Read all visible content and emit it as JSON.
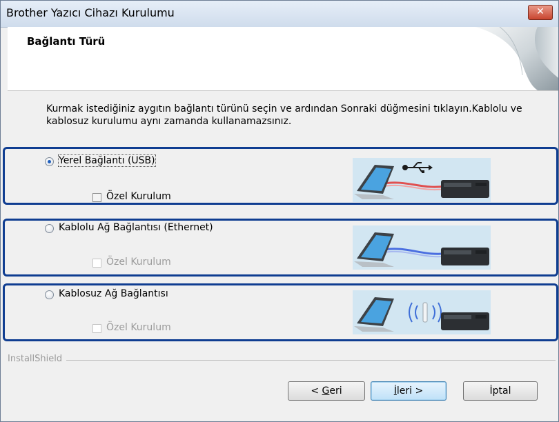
{
  "window": {
    "title": "Brother Yazıcı Cihazı Kurulumu",
    "close_glyph": "✕"
  },
  "header": {
    "heading": "Bağlantı Türü"
  },
  "instructions": "Kurmak istediğiniz aygıtın bağlantı türünü seçin ve ardından Sonraki düğmesini tıklayın.Kablolu ve kablosuz kurulumu aynı zamanda kullanamazsınız.",
  "options": [
    {
      "label": "Yerel Bağlantı (USB)",
      "selected": true,
      "custom_label": "Özel Kurulum",
      "custom_enabled": true,
      "image": "usb-connection-illustration"
    },
    {
      "label": "Kablolu Ağ Bağlantısı (Ethernet)",
      "selected": false,
      "custom_label": "Özel Kurulum",
      "custom_enabled": false,
      "image": "ethernet-connection-illustration"
    },
    {
      "label": "Kablosuz Ağ Bağlantısı",
      "selected": false,
      "custom_label": "Özel Kurulum",
      "custom_enabled": false,
      "image": "wireless-connection-illustration"
    }
  ],
  "footer": {
    "brand": "InstallShield"
  },
  "buttons": {
    "back_prefix": "< ",
    "back_key": "G",
    "back_rest": "eri",
    "next_key": "İ",
    "next_rest": "leri >",
    "cancel": "İptal"
  },
  "colors": {
    "highlight_frame": "#0f3d91",
    "usb_cable": "#e05050",
    "ethernet_cable": "#4a6ee0",
    "wifi_waves": "#3f6fd8"
  }
}
